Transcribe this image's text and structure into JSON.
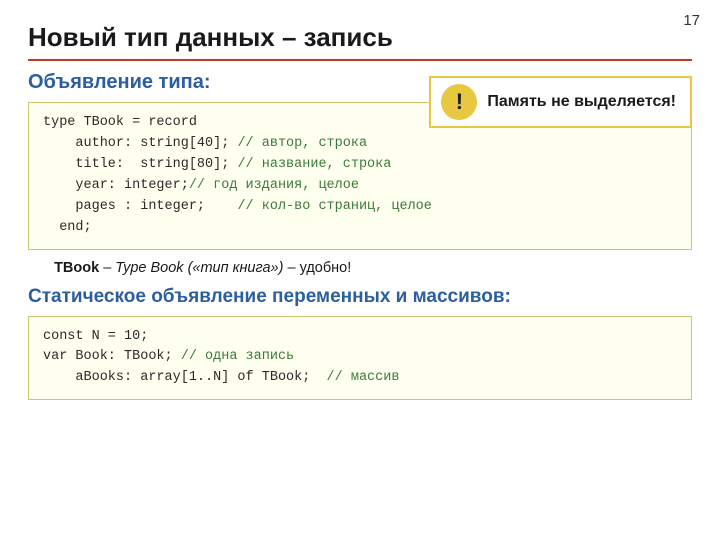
{
  "slide": {
    "number": "17",
    "title": "Новый тип данных – запись",
    "section1_label": "Объявление типа:",
    "warning": {
      "icon": "!",
      "text": "Память не выделяется!"
    },
    "code_block1": {
      "lines": [
        {
          "text": "type TBook = record",
          "comment": ""
        },
        {
          "text": "    author: string[40]; ",
          "comment": "// автор, строка"
        },
        {
          "text": "    title:  string[80]; ",
          "comment": "// название, строка"
        },
        {
          "text": "    year: integer;",
          "comment": "// год издания, целое"
        },
        {
          "text": "    pages : integer;    ",
          "comment": "// кол-во страниц, целое"
        },
        {
          "text": "  end;",
          "comment": ""
        }
      ]
    },
    "note": "TBook – Type Book («тип книга») – удобно!",
    "section2_label": "Статическое объявление переменных и массивов:",
    "code_block2": {
      "lines": [
        {
          "text": "const N = 10;",
          "comment": ""
        },
        {
          "text": "var Book: TBook; ",
          "comment": "// одна запись"
        },
        {
          "text": "    aBooks: array[1..N] of TBook;  ",
          "comment": "// массив"
        }
      ]
    }
  }
}
